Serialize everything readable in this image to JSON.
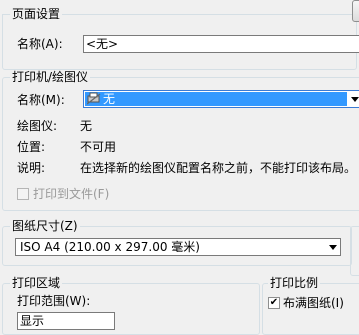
{
  "page_setup": {
    "title": "页面设置",
    "name_label": "名称(A):",
    "name_value": "<无>"
  },
  "printer": {
    "title": "打印机/绘图仪",
    "name_label": "名称(M):",
    "name_value": "无",
    "plotter_label": "绘图仪:",
    "plotter_value": "无",
    "location_label": "位置:",
    "location_value": "不可用",
    "desc_label": "说明:",
    "desc_value": "在选择新的绘图仪配置名称之前，不能打印该布局。",
    "print_to_file_label": "打印到文件(F)",
    "print_to_file_checked": false
  },
  "paper": {
    "title": "图纸尺寸(Z)",
    "value": "ISO A4 (210.00 x 297.00 毫米)"
  },
  "print_area": {
    "title": "打印区域",
    "range_label": "打印范围(W):",
    "range_value": "显示"
  },
  "scale": {
    "title": "打印比例",
    "fit_label": "布满图纸(I)",
    "fit_checked": true
  }
}
